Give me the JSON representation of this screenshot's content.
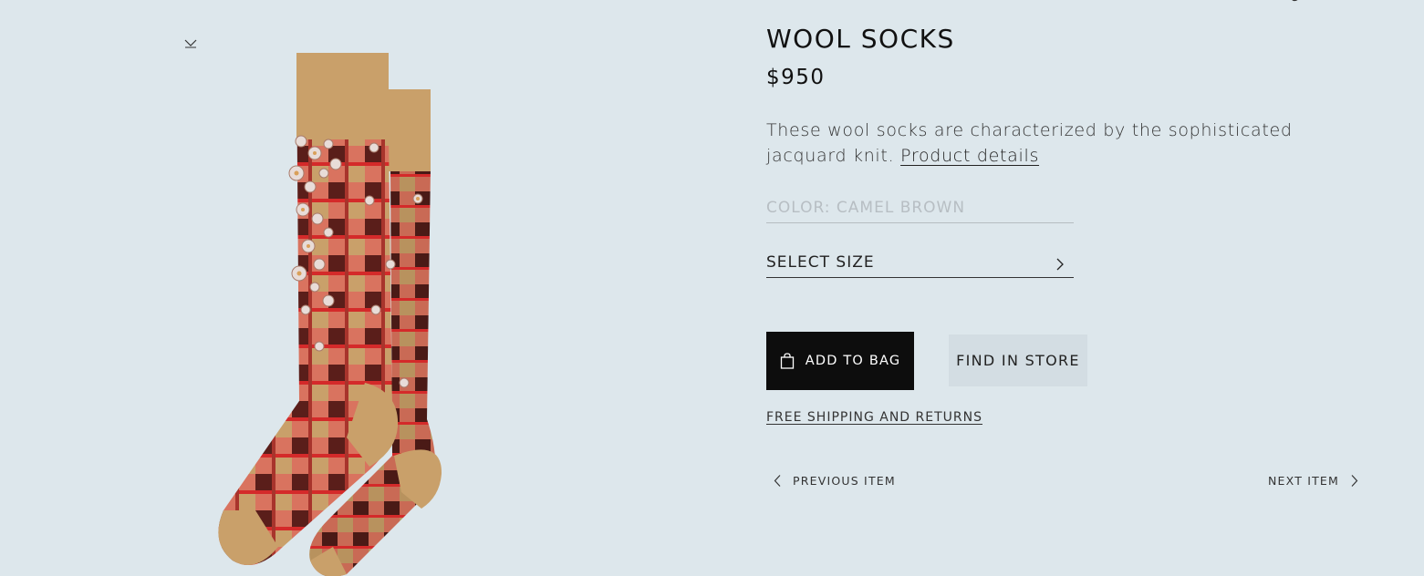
{
  "product": {
    "title": "WOOL SOCKS",
    "price": "$950",
    "description": "These wool socks are characterized by the sophisticated jacquard knit.",
    "details_link": "Product details",
    "color_label": "COLOR: CAMEL BROWN",
    "size_label": "SELECT SIZE"
  },
  "actions": {
    "add_to_bag": "ADD TO BAG",
    "find_in_store": "FIND IN STORE",
    "shipping": "FREE SHIPPING AND RETURNS"
  },
  "navigation": {
    "previous": "PREVIOUS ITEM",
    "next": "NEXT ITEM"
  },
  "icons": {
    "bag": "shopping-bag-icon",
    "chevron_right": "chevron-right-icon",
    "chevron_left": "chevron-left-icon",
    "scroll_down": "chevron-down-icon"
  },
  "colors": {
    "background": "#dde7ec",
    "primary_button": "#0d0d0d",
    "secondary_button": "#d3dde3",
    "camel": "#c9a06a",
    "red": "#d42a2a",
    "burgundy": "#5a1e1a"
  }
}
